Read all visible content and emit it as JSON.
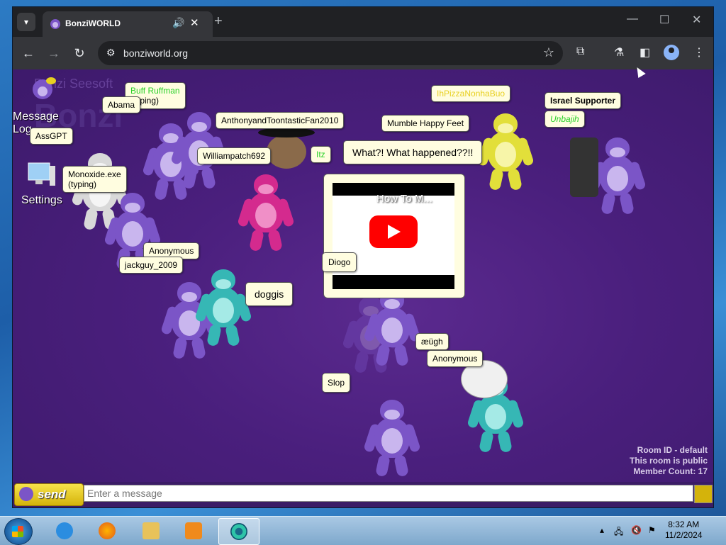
{
  "browser": {
    "tab_title": "BonziWORLD",
    "url": "bonziworld.org",
    "new_tab_label": "+"
  },
  "sidebar": {
    "bg_logo_top": "Bonzi Seesoft",
    "bg_logo_big": "Bonzi",
    "message_log_line1": "Message",
    "message_log_line2": "Log",
    "settings": "Settings"
  },
  "bubbles": {
    "buff": "Buff Ruffman",
    "buff_typing": "(typing)",
    "abama": "Abama",
    "assgpt": "AssGPT",
    "anthony": "AnthonyandToontasticFan2010",
    "william": "Williampatch692",
    "monoxide": "Monoxide.exe",
    "monoxide_typing": "(typing)",
    "anonymous1": "Anonymous",
    "jackguy": "jackguy_2009",
    "diogo": "Diogo",
    "doggis": "doggis",
    "what": "What?! What happened??!!",
    "itz": "Itz",
    "mumble": "Mumble Happy Feet",
    "ih": "IhPizzaNonhaBuo",
    "israel": "Israel Supporter",
    "unbajih": "Unbajih",
    "augh": "æügh",
    "anonymous2": "Anonymous",
    "slop": "Slop"
  },
  "video": {
    "title": "How To M..."
  },
  "room": {
    "id_label": "Room ID - default",
    "public_label": "This room is public",
    "member_count_label": "Member Count: 17"
  },
  "chat": {
    "send_label": "send",
    "placeholder": "Enter a message"
  },
  "taskbar": {
    "time": "8:32 AM",
    "date": "11/2/2024"
  }
}
